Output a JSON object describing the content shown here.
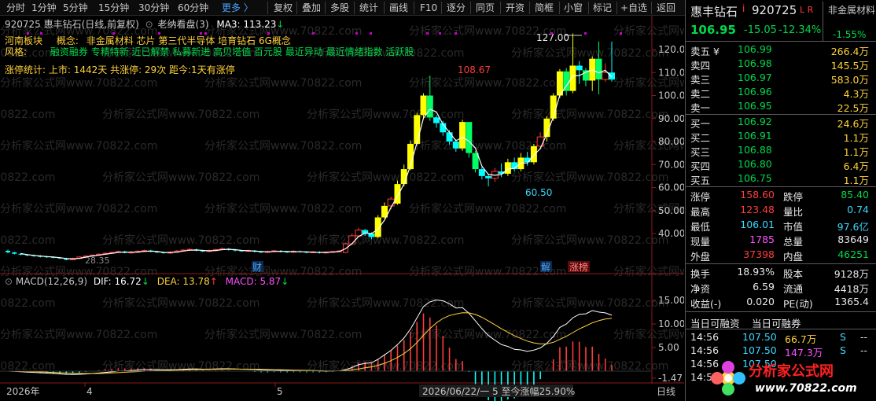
{
  "toolbar": {
    "left": [
      "分时",
      "1分钟",
      "5分钟",
      "15分钟",
      "30分钟",
      "60分钟"
    ],
    "more": "更多 〉",
    "right": [
      "复权",
      "叠加",
      "多股",
      "统计",
      "画线",
      "F10",
      "逐分",
      "同页",
      "开资",
      "简框",
      "小窗",
      "标记",
      "+自选",
      "返回"
    ]
  },
  "chart_header": {
    "stock": "920725 惠丰钻石(日线,前复权)",
    "indicator": "老纳看盘(3)",
    "ma": "MA3: 113.23",
    "ma_arrow": "↓"
  },
  "info": {
    "sector_label": "河南板块",
    "concept_label": "概念:",
    "concepts": "非金属材料  芯片 第三代半导体 培育钻石 6G概念",
    "style_label": "风格:",
    "styles": "融资融券 专精特新 近已解禁 私募新进 高贝塔值 百元股 最近异动 最近情绪指数 活跃股",
    "limit_stats": "涨停统计:   上市: 1442天   共涨停: 29次   距今:1天有涨停"
  },
  "price_axis": [
    "120.0",
    "110.0",
    "100.0",
    "90.00",
    "80.00",
    "70.00",
    "60.00",
    "50.00",
    "40.00"
  ],
  "annotations": {
    "high_peak": "127.00",
    "mid_peak": "108.67",
    "trough": "60.50",
    "left_low": "28.35",
    "marker_cai": "财",
    "marker_jie": "解",
    "marker_zhangbang": "涨榜"
  },
  "macd": {
    "header": "MACD(12,26,9)",
    "dif": "DIF: 16.72",
    "dif_arrow": "↓",
    "dea": "DEA: 13.78",
    "dea_arrow": "↑",
    "macd": "MACD: 5.87",
    "macd_arrow": "↓",
    "axis": [
      "15.00",
      "10.00",
      "5.00",
      "-1.47"
    ]
  },
  "time_axis": {
    "year": "2026年",
    "m4": "4",
    "m5": "5",
    "cursor": "2026/06/22/一 5 至今涨幅25.90%",
    "period": "日线"
  },
  "watermark": "分析家公式网www.70822.com",
  "quote": {
    "name": "惠丰钻石",
    "name_flag": "i",
    "code": "920725",
    "lr": "L R",
    "industry": "非金属材料",
    "industry_pct": "-1.55%",
    "price": "106.95",
    "change": "-15.05",
    "pct": "-12.34%"
  },
  "asks": [
    {
      "label": "卖五 ¥",
      "price": "106.99",
      "vol": "266.4万"
    },
    {
      "label": "卖四",
      "price": "106.98",
      "vol": "145.5万"
    },
    {
      "label": "卖三",
      "price": "106.97",
      "vol": "583.0万"
    },
    {
      "label": "卖二",
      "price": "106.96",
      "vol": "4.3万"
    },
    {
      "label": "卖一",
      "price": "106.95",
      "vol": "22.5万"
    }
  ],
  "bids": [
    {
      "label": "买一",
      "price": "106.92",
      "vol": "24.6万"
    },
    {
      "label": "买二",
      "price": "106.91",
      "vol": "1.1万"
    },
    {
      "label": "买三",
      "price": "106.88",
      "vol": "1.1万"
    },
    {
      "label": "买四",
      "price": "106.80",
      "vol": "6.4万"
    },
    {
      "label": "买五",
      "price": "106.75",
      "vol": "1.1万"
    }
  ],
  "stats1": [
    {
      "l1": "涨停",
      "v1": "158.60",
      "c1": "up",
      "l2": "跌停",
      "v2": "85.40",
      "c2": "dn"
    },
    {
      "l1": "最高",
      "v1": "123.48",
      "c1": "up",
      "l2": "量比",
      "v2": "0.74",
      "c2": "cy"
    },
    {
      "l1": "最低",
      "v1": "106.01",
      "c1": "cy",
      "l2": "市值",
      "v2": "97.6亿",
      "c2": "cy"
    },
    {
      "l1": "现量",
      "v1": "1785",
      "c1": "mg",
      "l2": "总量",
      "v2": "83649",
      "c2": "wh"
    },
    {
      "l1": "外盘",
      "v1": "37398",
      "c1": "up",
      "l2": "内盘",
      "v2": "46251",
      "c2": "dn"
    }
  ],
  "stats2": [
    {
      "l1": "换手",
      "v1": "18.93%",
      "l2": "股本",
      "v2": "9128万"
    },
    {
      "l1": "净资",
      "v1": "6.59",
      "l2": "流通",
      "v2": "4418万"
    },
    {
      "l1": "收益(-)",
      "v1": "0.020",
      "l2": "PE(动)",
      "v2": "1365.4"
    }
  ],
  "margin": {
    "tab1": "当日可融资",
    "tab2": "当日可融券"
  },
  "ticks": [
    {
      "time": "14:56",
      "price": "107.50",
      "vol": "66.7万",
      "side": "S",
      "extra": "--",
      "vc": "yl"
    },
    {
      "time": "14:56",
      "price": "107.50",
      "vol": "147.3万",
      "side": "S",
      "extra": "--",
      "vc": "mg"
    },
    {
      "time": "14:56",
      "price": "107.50",
      "vol": "",
      "side": "",
      "extra": "",
      "vc": "yl"
    },
    {
      "time": "14:56",
      "price": "",
      "vol": "",
      "side": "",
      "extra": "",
      "vc": "yl"
    }
  ],
  "logo": {
    "text": "分析家公式网",
    "url": "www.70822.com"
  },
  "colors": {
    "up": "#ff3b3b",
    "down": "#00ffff",
    "ma": "#ffffff",
    "dea": "#ffd23a",
    "macd_label": "#ff4fff"
  }
}
